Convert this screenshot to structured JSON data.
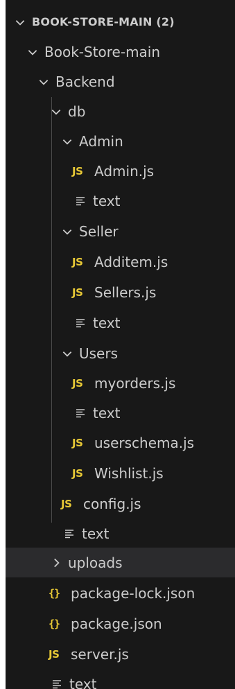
{
  "explorer": {
    "root_label": "BOOK-STORE-MAIN (2)",
    "items": [
      {
        "label": "Book-Store-main",
        "type": "folder",
        "expanded": true
      },
      {
        "label": "Backend",
        "type": "folder",
        "expanded": true
      },
      {
        "label": "db",
        "type": "folder",
        "expanded": true
      },
      {
        "label": "Admin",
        "type": "folder",
        "expanded": true
      },
      {
        "label": "Admin.js",
        "type": "js"
      },
      {
        "label": "text",
        "type": "text"
      },
      {
        "label": "Seller",
        "type": "folder",
        "expanded": true
      },
      {
        "label": "Additem.js",
        "type": "js"
      },
      {
        "label": "Sellers.js",
        "type": "js"
      },
      {
        "label": "text",
        "type": "text"
      },
      {
        "label": "Users",
        "type": "folder",
        "expanded": true
      },
      {
        "label": "myorders.js",
        "type": "js"
      },
      {
        "label": "text",
        "type": "text"
      },
      {
        "label": "userschema.js",
        "type": "js"
      },
      {
        "label": "Wishlist.js",
        "type": "js"
      },
      {
        "label": "config.js",
        "type": "js"
      },
      {
        "label": "text",
        "type": "text"
      },
      {
        "label": "uploads",
        "type": "folder",
        "expanded": false,
        "selected": true
      },
      {
        "label": "package-lock.json",
        "type": "json"
      },
      {
        "label": "package.json",
        "type": "json"
      },
      {
        "label": "server.js",
        "type": "js"
      },
      {
        "label": "text",
        "type": "text"
      }
    ],
    "icons": {
      "js_glyph": "JS",
      "json_glyph": "{}"
    },
    "colors": {
      "background": "#181818",
      "selected_row": "#2b2b2d",
      "text": "#cccccc",
      "js_icon": "#e8c936",
      "json_icon": "#e8c936"
    }
  }
}
